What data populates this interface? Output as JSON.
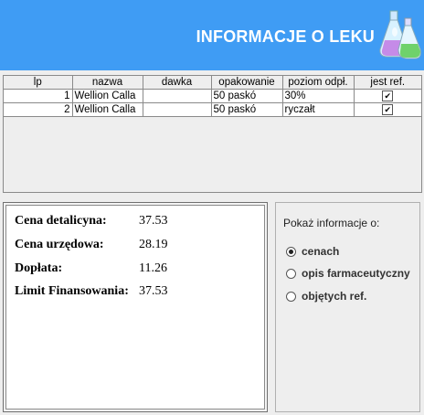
{
  "header": {
    "title": "INFORMACJE O LEKU"
  },
  "table": {
    "columns": [
      "lp",
      "nazwa",
      "dawka",
      "opakowanie",
      "poziom odpł.",
      "jest ref."
    ],
    "rows": [
      {
        "lp": "1",
        "nazwa": "Wellion Calla",
        "dawka": "",
        "opakowanie": "50 paskó",
        "poziom": "30%",
        "jest_ref": true
      },
      {
        "lp": "2",
        "nazwa": "Wellion Calla",
        "dawka": "",
        "opakowanie": "50 paskó",
        "poziom": "ryczałt",
        "jest_ref": true
      }
    ]
  },
  "info": {
    "cena_detaliczna": {
      "label": "Cena detalicyna:",
      "value": "37.53"
    },
    "cena_urzedowa": {
      "label": "Cena urzędowa:",
      "value": "28.19"
    },
    "doplata": {
      "label": "Dopłata:",
      "value": "11.26"
    },
    "limit": {
      "label": "Limit Finansowania:",
      "value": "37.53"
    }
  },
  "side": {
    "title": "Pokaż informacje o:",
    "options": [
      {
        "label": "cenach",
        "selected": true
      },
      {
        "label": "opis farmaceutyczny",
        "selected": false
      },
      {
        "label": "objętych ref.",
        "selected": false
      }
    ]
  }
}
